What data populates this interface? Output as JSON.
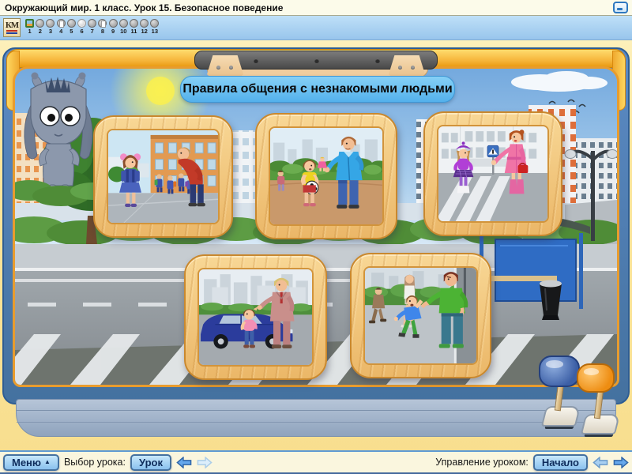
{
  "window": {
    "title": "Окружающий мир. 1 класс. Урок 15. Безопасное поведение"
  },
  "toolbar": {
    "logo_text": "КМ",
    "current_slide": "6",
    "slides": [
      {
        "num": "1",
        "type": "image",
        "current": false
      },
      {
        "num": "2",
        "type": "dot",
        "current": false
      },
      {
        "num": "3",
        "type": "dot",
        "current": false
      },
      {
        "num": "4",
        "type": "page",
        "current": false
      },
      {
        "num": "5",
        "type": "dot",
        "current": false
      },
      {
        "num": "6",
        "type": "dot",
        "current": true
      },
      {
        "num": "7",
        "type": "dot",
        "current": false
      },
      {
        "num": "8",
        "type": "page",
        "current": false
      },
      {
        "num": "9",
        "type": "dot",
        "current": false
      },
      {
        "num": "10",
        "type": "dot",
        "current": false
      },
      {
        "num": "11",
        "type": "dot",
        "current": false
      },
      {
        "num": "12",
        "type": "dot",
        "current": false
      },
      {
        "num": "13",
        "type": "dot",
        "current": false
      }
    ]
  },
  "banner": {
    "text": "Правила общения с незнакомыми людьми"
  },
  "photos": [
    {
      "name": "girl-with-stranger-near-school"
    },
    {
      "name": "boy-with-ball-offered-toy-by-stranger"
    },
    {
      "name": "girl-with-stranger-woman-at-crosswalk"
    },
    {
      "name": "boy-invited-into-car-by-stranger"
    },
    {
      "name": "stranger-grabbing-boy"
    }
  ],
  "scene": {
    "mascot": "gray-alien-donkey-mascot",
    "setting": "city-street-with-bus-stop-and-crosswalk"
  },
  "footer": {
    "menu_button": "Меню",
    "menu_arrow": "▲",
    "lesson_select_label": "Выбор урока:",
    "lesson_button": "Урок",
    "lesson_prev_enabled": true,
    "lesson_next_enabled": false,
    "control_label": "Управление уроком:",
    "start_button": "Начало",
    "control_prev_enabled": true,
    "control_next_enabled": true
  },
  "colors": {
    "toolbar_bg": "#A9D6F2",
    "banner_bg": "#58B6F0",
    "frame_gold": "#F2B13C",
    "shell_blue": "#4E80B8",
    "wood_frame": "#EFC27A",
    "button_blue": "#9FD0F2",
    "knob_blue": "#3C5FA6",
    "knob_orange": "#EF8F1E"
  }
}
